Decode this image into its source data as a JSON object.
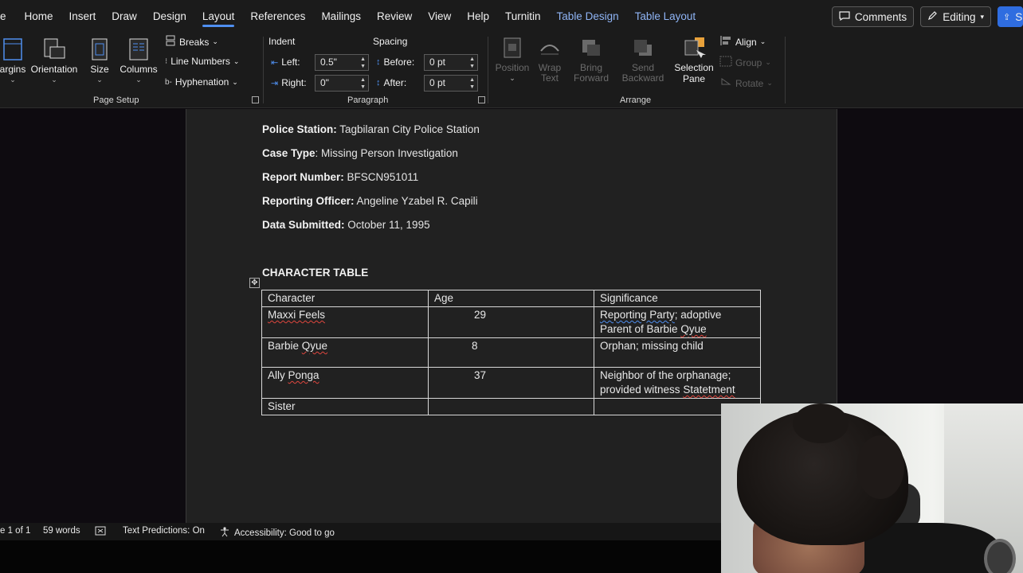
{
  "menubar": {
    "file_partial": "e",
    "tabs": [
      "Home",
      "Insert",
      "Draw",
      "Design",
      "Layout",
      "References",
      "Mailings",
      "Review",
      "View",
      "Help",
      "Turnitin",
      "Table Design",
      "Table Layout"
    ],
    "active_tab": "Layout",
    "comments_label": "Comments",
    "editing_label": "Editing",
    "share_partial": "S"
  },
  "ribbon": {
    "page_setup": {
      "margins_partial": "argins",
      "orientation": "Orientation",
      "size": "Size",
      "columns": "Columns",
      "breaks": "Breaks",
      "line_numbers": "Line Numbers",
      "hyphenation": "Hyphenation",
      "group_label": "Page Setup"
    },
    "paragraph": {
      "indent_header": "Indent",
      "spacing_header": "Spacing",
      "left_label": "Left:",
      "left_value": "0.5\"",
      "right_label": "Right:",
      "right_value": "0\"",
      "before_label": "Before:",
      "before_value": "0 pt",
      "after_label": "After:",
      "after_value": "0 pt",
      "group_label": "Paragraph"
    },
    "arrange": {
      "position": "Position",
      "wrap_text_1": "Wrap",
      "wrap_text_2": "Text",
      "bring_forward_1": "Bring",
      "bring_forward_2": "Forward",
      "send_backward_1": "Send",
      "send_backward_2": "Backward",
      "selection_pane_1": "Selection",
      "selection_pane_2": "Pane",
      "align": "Align",
      "group": "Group",
      "rotate": "Rotate",
      "group_label": "Arrange"
    }
  },
  "document": {
    "fields": [
      {
        "label": "Police Station:",
        "value": " Tagbilaran City Police Station"
      },
      {
        "label": "Case Type",
        "value": ": Missing Person Investigation"
      },
      {
        "label": "Report Number:",
        "value": " BFSCN951011"
      },
      {
        "label": "Reporting Officer:",
        "value": " Angeline Yzabel R. Capili"
      },
      {
        "label": "Data Submitted:",
        "value": " October 11, 1995"
      }
    ],
    "table_title": "CHARACTER TABLE",
    "table": {
      "headers": [
        "Character",
        "Age",
        "Significance"
      ],
      "rows": [
        {
          "character": "Maxxi Feels",
          "age": "29",
          "sig1": "Reporting  Party",
          "sig2": "; adoptive",
          "sig3": "Parent of Barbie ",
          "sig4": "Qyue"
        },
        {
          "character_1": "Barbie ",
          "character_2": "Qyue",
          "age": "8",
          "significance": "Orphan; missing child"
        },
        {
          "character_1": "Ally ",
          "character_2": "Ponga",
          "age": "37",
          "sig1": "Neighbor of the orphanage;",
          "sig2": "provided witness ",
          "sig3": "Statetment"
        },
        {
          "character": "Sister",
          "age": "",
          "significance": ""
        }
      ]
    }
  },
  "statusbar": {
    "page": "e 1 of 1",
    "words": "59 words",
    "text_predictions": "Text Predictions: On",
    "accessibility": "Accessibility: Good to go"
  }
}
